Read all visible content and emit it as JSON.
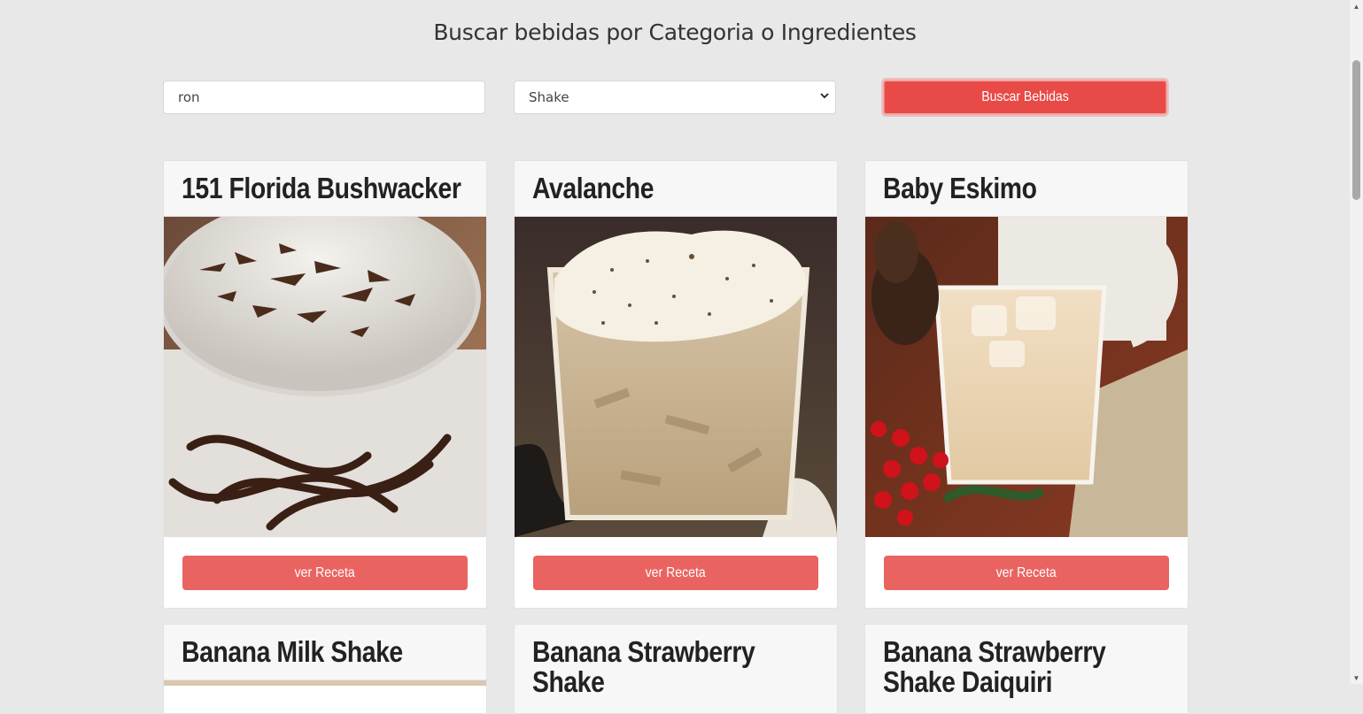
{
  "header": {
    "title": "Buscar bebidas por Categoria o Ingredientes"
  },
  "search": {
    "value": "ron",
    "category_selected": "Shake",
    "button_label": "Buscar Bebidas"
  },
  "cards": [
    {
      "title": "151 Florida Bushwacker",
      "button_label": "ver Receta"
    },
    {
      "title": "Avalanche",
      "button_label": "ver Receta"
    },
    {
      "title": "Baby Eskimo",
      "button_label": "ver Receta"
    },
    {
      "title": "Banana Milk Shake"
    },
    {
      "title": "Banana Strawberry Shake"
    },
    {
      "title": "Banana Strawberry Shake Daiquiri"
    }
  ],
  "colors": {
    "accent": "#e84a47",
    "card_button": "#e96461",
    "background": "#e8e8e8"
  }
}
